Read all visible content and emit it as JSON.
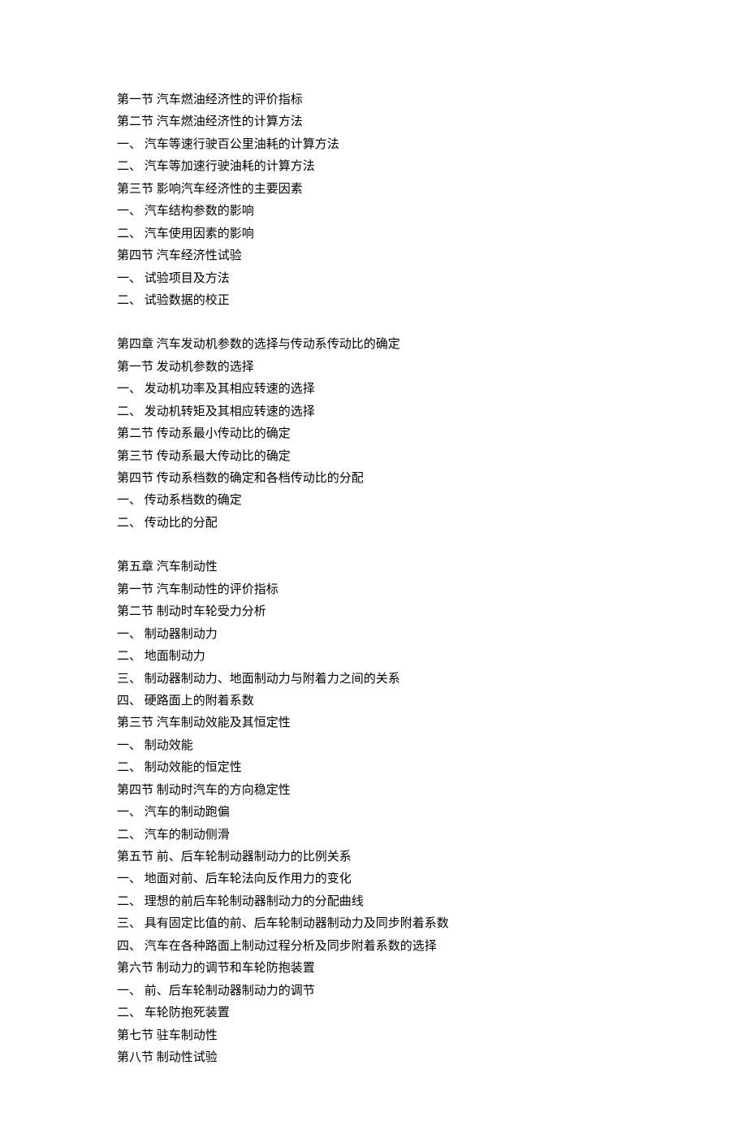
{
  "lines": [
    "第一节 汽车燃油经济性的评价指标",
    "第二节 汽车燃油经济性的计算方法",
    "一、 汽车等速行驶百公里油耗的计算方法",
    "二、 汽车等加速行驶油耗的计算方法",
    "第三节 影响汽车经济性的主要因素",
    "一、 汽车结构参数的影响",
    "二、 汽车使用因素的影响",
    "第四节 汽车经济性试验",
    "一、 试验项目及方法",
    "二、 试验数据的校正",
    "",
    "第四章 汽车发动机参数的选择与传动系传动比的确定",
    "第一节 发动机参数的选择",
    "一、 发动机功率及其相应转速的选择",
    "二、 发动机转矩及其相应转速的选择",
    "第二节 传动系最小传动比的确定",
    "第三节 传动系最大传动比的确定",
    "第四节 传动系档数的确定和各档传动比的分配",
    "一、 传动系档数的确定",
    "二、 传动比的分配",
    "",
    "第五章 汽车制动性",
    "第一节 汽车制动性的评价指标",
    "第二节 制动时车轮受力分析",
    "一、 制动器制动力",
    "二、 地面制动力",
    "三、 制动器制动力、地面制动力与附着力之间的关系",
    "四、 硬路面上的附着系数",
    "第三节 汽车制动效能及其恒定性",
    "一、 制动效能",
    "二、 制动效能的恒定性",
    "第四节 制动时汽车的方向稳定性",
    "一、 汽车的制动跑偏",
    "二、 汽车的制动侧滑",
    "第五节 前、后车轮制动器制动力的比例关系",
    "一、 地面对前、后车轮法向反作用力的变化",
    "二、 理想的前后车轮制动器制动力的分配曲线",
    "三、 具有固定比值的前、后车轮制动器制动力及同步附着系数",
    "四、 汽车在各种路面上制动过程分析及同步附着系数的选择",
    "第六节 制动力的调节和车轮防抱装置",
    "一、 前、后车轮制动器制动力的调节",
    "二、 车轮防抱死装置",
    "第七节 驻车制动性",
    "第八节 制动性试验"
  ]
}
